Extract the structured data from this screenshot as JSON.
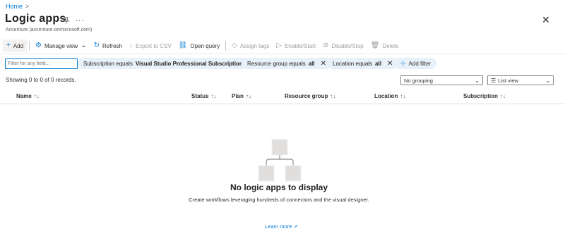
{
  "breadcrumb": {
    "home": "Home",
    "separator": ">"
  },
  "header": {
    "title": "Logic apps",
    "subtitle": "Accenture (accenture.onmicrosoft.com)",
    "pin_icon": "pin-icon",
    "more_label": "...",
    "close_label": "✕"
  },
  "toolbar": {
    "add": "Add",
    "manage_view": "Manage view",
    "refresh": "Refresh",
    "export_csv": "Export to CSV",
    "open_query": "Open query",
    "assign_tags": "Assign tags",
    "enable_start": "Enable/Start",
    "disable_stop": "Disable/Stop",
    "delete": "Delete"
  },
  "filters": {
    "placeholder": "Filter for any field...",
    "subscription": {
      "prefix": "Subscription equals ",
      "value": "Visual Studio Professional Subscription"
    },
    "resource_group": {
      "prefix": "Resource group equals ",
      "value": "all"
    },
    "location": {
      "prefix": "Location equals ",
      "value": "all"
    },
    "add_filter": "Add filter"
  },
  "records_text": "Showing 0 to 0 of 0 records.",
  "grouping": {
    "selected": "No grouping"
  },
  "view": {
    "selected": "List view"
  },
  "table": {
    "columns": [
      "Name",
      "Status",
      "Plan",
      "Resource group",
      "Location",
      "Subscription"
    ],
    "sort_glyph": "↑↓"
  },
  "empty": {
    "title": "No logic apps to display",
    "description": "Create workflows leveraging hundreds of connectors and the visual designer.",
    "learn_more": "Learn more"
  },
  "colors": {
    "accent": "#0078d4",
    "pill_bg": "#e8f0f9",
    "disabled": "#a19f9d"
  }
}
